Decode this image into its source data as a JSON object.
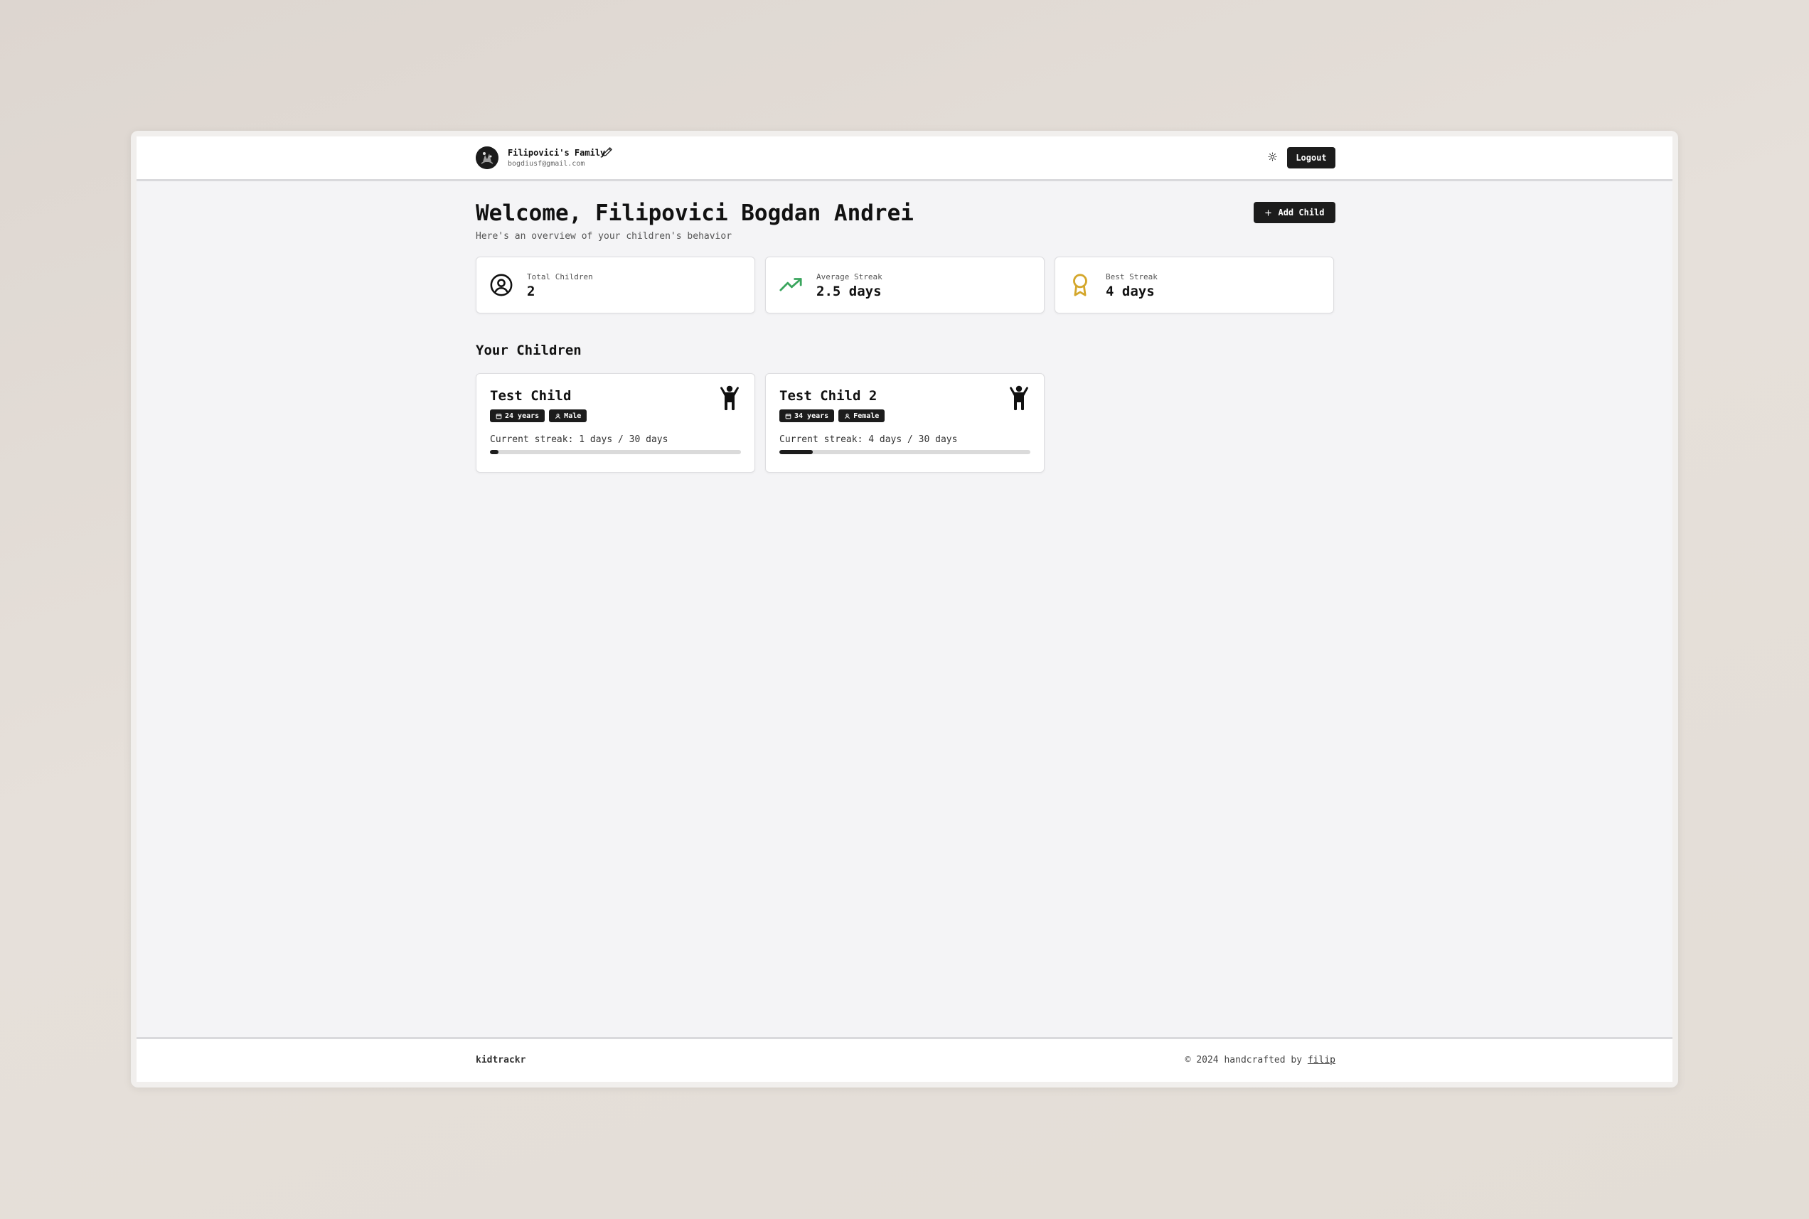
{
  "header": {
    "family_name": "Filipovici's Family",
    "email": "bogdiusf@gmail.com",
    "logout_label": "Logout"
  },
  "welcome": {
    "title": "Welcome, Filipovici Bogdan Andrei",
    "subtitle": "Here's an overview of your children's behavior",
    "add_child_label": "Add Child"
  },
  "stats": [
    {
      "label": "Total Children",
      "value": "2",
      "icon": "user-circle-icon"
    },
    {
      "label": "Average Streak",
      "value": "2.5 days",
      "icon": "trending-up-icon",
      "color": "#3aa55d"
    },
    {
      "label": "Best Streak",
      "value": "4 days",
      "icon": "award-icon",
      "color": "#d4a72c"
    }
  ],
  "children_section": {
    "title": "Your Children",
    "children": [
      {
        "name": "Test Child",
        "age": "24 years",
        "gender": "Male",
        "streak_text": "Current streak: 1 days / 30 days",
        "streak_fraction": 0.0333
      },
      {
        "name": "Test Child 2",
        "age": "34 years",
        "gender": "Female",
        "streak_text": "Current streak: 4 days / 30 days",
        "streak_fraction": 0.1333
      }
    ]
  },
  "footer": {
    "brand": "kidtrackr",
    "copy": "© 2024 handcrafted by ",
    "author": "filip"
  },
  "colors": {
    "primary": "#1c1c1c",
    "background": "#f4f4f6",
    "success": "#3aa55d",
    "gold": "#d4a72c"
  }
}
